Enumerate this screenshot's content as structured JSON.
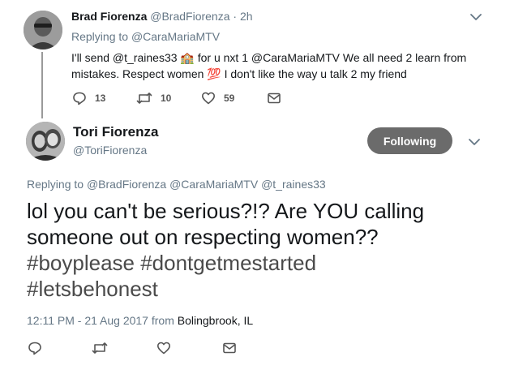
{
  "parent_tweet": {
    "author_name": "Brad Fiorenza",
    "author_handle": "@BradFiorenza",
    "separator": "·",
    "time": "2h",
    "replying_prefix": "Replying to",
    "replying_to": "@CaraMariaMTV",
    "text_line1": "I'll send @t_raines33 🏫 for u nxt 1 @CaraMariaMTV We all need 2 learn from",
    "text_line2": "mistakes. Respect women 💯 I don't like the way u talk 2 my friend",
    "reply_count": "13",
    "retweet_count": "10",
    "like_count": "59"
  },
  "main_tweet": {
    "author_name": "Tori Fiorenza",
    "author_handle": "@ToriFiorenza",
    "follow_label": "Following",
    "replying_prefix": "Replying to",
    "replying_to": "@BradFiorenza @CaraMariaMTV @t_raines33",
    "text_line1": "lol you can't be serious?!? Are YOU calling",
    "text_line2": "someone out on respecting women??",
    "text_line3": "#boyplease #dontgetmestarted",
    "text_line4": "#letsbehonest",
    "timestamp": "12:11 PM - 21 Aug 2017",
    "from_prefix": "from",
    "location": "Bolingbrook, IL"
  },
  "icons": {
    "reply": "reply-icon",
    "retweet": "retweet-icon",
    "like": "heart-icon",
    "dm": "envelope-icon",
    "menu": "chevron-down-icon"
  },
  "colors": {
    "follow_button": "#6b6b6b",
    "muted_text": "#657786",
    "thread_line": "#9a9a9a"
  }
}
